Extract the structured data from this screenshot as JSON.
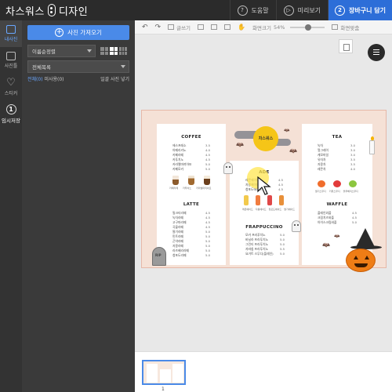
{
  "app": {
    "logo_left": "차스워스",
    "logo_right": "디자인"
  },
  "topbar": {
    "help": "도움말",
    "preview": "미리보기",
    "cart_step": "2",
    "cart": "장바구니 담기"
  },
  "rail": {
    "items": [
      {
        "label": "내사진",
        "icon": "photo-icon"
      },
      {
        "label": "사진틀",
        "icon": "frame-icon"
      },
      {
        "label": "스티커",
        "icon": "heart-icon"
      },
      {
        "label": "임시저장",
        "icon": "number-one-icon",
        "num": "1"
      }
    ]
  },
  "panel": {
    "upload_label": "사진 가져오기",
    "sort_label": "이름순정렬",
    "folder_label": "전체목록",
    "selected_count": "전체(0)",
    "used_count": "미사용(0)",
    "hide_used": "일괄 사진 넣기"
  },
  "toolbar": {
    "text_tool": "글쓰기",
    "zoom_label": "화면크기",
    "zoom_value": "54%",
    "fit_label": "화면맞춤"
  },
  "menu": {
    "coffee": {
      "title": "COFFEE",
      "items": [
        {
          "name": "에스프레소",
          "price": "3.5"
        },
        {
          "name": "아메리카노",
          "price": "4.0"
        },
        {
          "name": "카페라떼",
          "price": "4.5"
        },
        {
          "name": "카푸치노",
          "price": "4.5"
        },
        {
          "name": "카라멜마끼아또",
          "price": "5.0"
        },
        {
          "name": "카페모카",
          "price": "5.0"
        }
      ],
      "cup_labels": [
        "카페라떼",
        "카푸치노",
        "카라멜마끼아또"
      ]
    },
    "latte": {
      "title": "LATTE",
      "items": [
        {
          "name": "밀크티라떼",
          "price": "4.5"
        },
        {
          "name": "녹차라떼",
          "price": "4.5"
        },
        {
          "name": "고구마라떼",
          "price": "4.5"
        },
        {
          "name": "곡물라떼",
          "price": "4.5"
        },
        {
          "name": "딸기라떼",
          "price": "5.0"
        },
        {
          "name": "민트라떼",
          "price": "5.0"
        },
        {
          "name": "곤약라떼",
          "price": "5.0"
        },
        {
          "name": "자몽라떼",
          "price": "5.0"
        },
        {
          "name": "라즈베리라떼",
          "price": "5.0"
        },
        {
          "name": "청포도라떼",
          "price": "5.0"
        }
      ]
    },
    "ade": {
      "title": "ADE",
      "items": [
        {
          "name": "레몬에이드",
          "price": "4.5"
        },
        {
          "name": "자몽에이드",
          "price": "4.5"
        },
        {
          "name": "청포도에이드",
          "price": "4.5"
        }
      ],
      "bottle_labels": [
        "레몬에이드",
        "자몽에이드",
        "청포도에이드",
        "딸기에이드"
      ]
    },
    "frappuccino": {
      "title": "FRAPPUCCINO",
      "items": [
        {
          "name": "모카 프라푸치노",
          "price": "5.0"
        },
        {
          "name": "바닐라 프라푸치노",
          "price": "5.0"
        },
        {
          "name": "그린티 프라푸치노",
          "price": "5.0"
        },
        {
          "name": "자바칩 프라푸치노",
          "price": "5.5"
        },
        {
          "name": "요거트 스무디(플레인)",
          "price": "5.0"
        }
      ]
    },
    "tea": {
      "title": "TEA",
      "items": [
        {
          "name": "녹차",
          "price": "3.0"
        },
        {
          "name": "얼그레이",
          "price": "3.0"
        },
        {
          "name": "캐모마일",
          "price": "3.0"
        },
        {
          "name": "유자차",
          "price": "3.5"
        },
        {
          "name": "자몽차",
          "price": "3.5"
        },
        {
          "name": "레몬차",
          "price": "4.0"
        }
      ],
      "fruit_labels": [
        "딸기스무디",
        "키위스무디",
        "블루베리스무디"
      ]
    },
    "waffle": {
      "title": "WAFFLE",
      "items": [
        {
          "name": "플레인와플",
          "price": "4.5"
        },
        {
          "name": "크림치즈와플",
          "price": "4.5"
        },
        {
          "name": "아이스크림와플",
          "price": "5.0"
        }
      ]
    },
    "moon_text": "차스워스"
  },
  "pages": {
    "page_number": "1"
  },
  "colors": {
    "accent": "#2d6ed8",
    "upload_button": "#4a8ae8",
    "topbar": "#2b2b2b",
    "panel": "#3a3a3a",
    "sheet_background": "#f5e1d6"
  }
}
